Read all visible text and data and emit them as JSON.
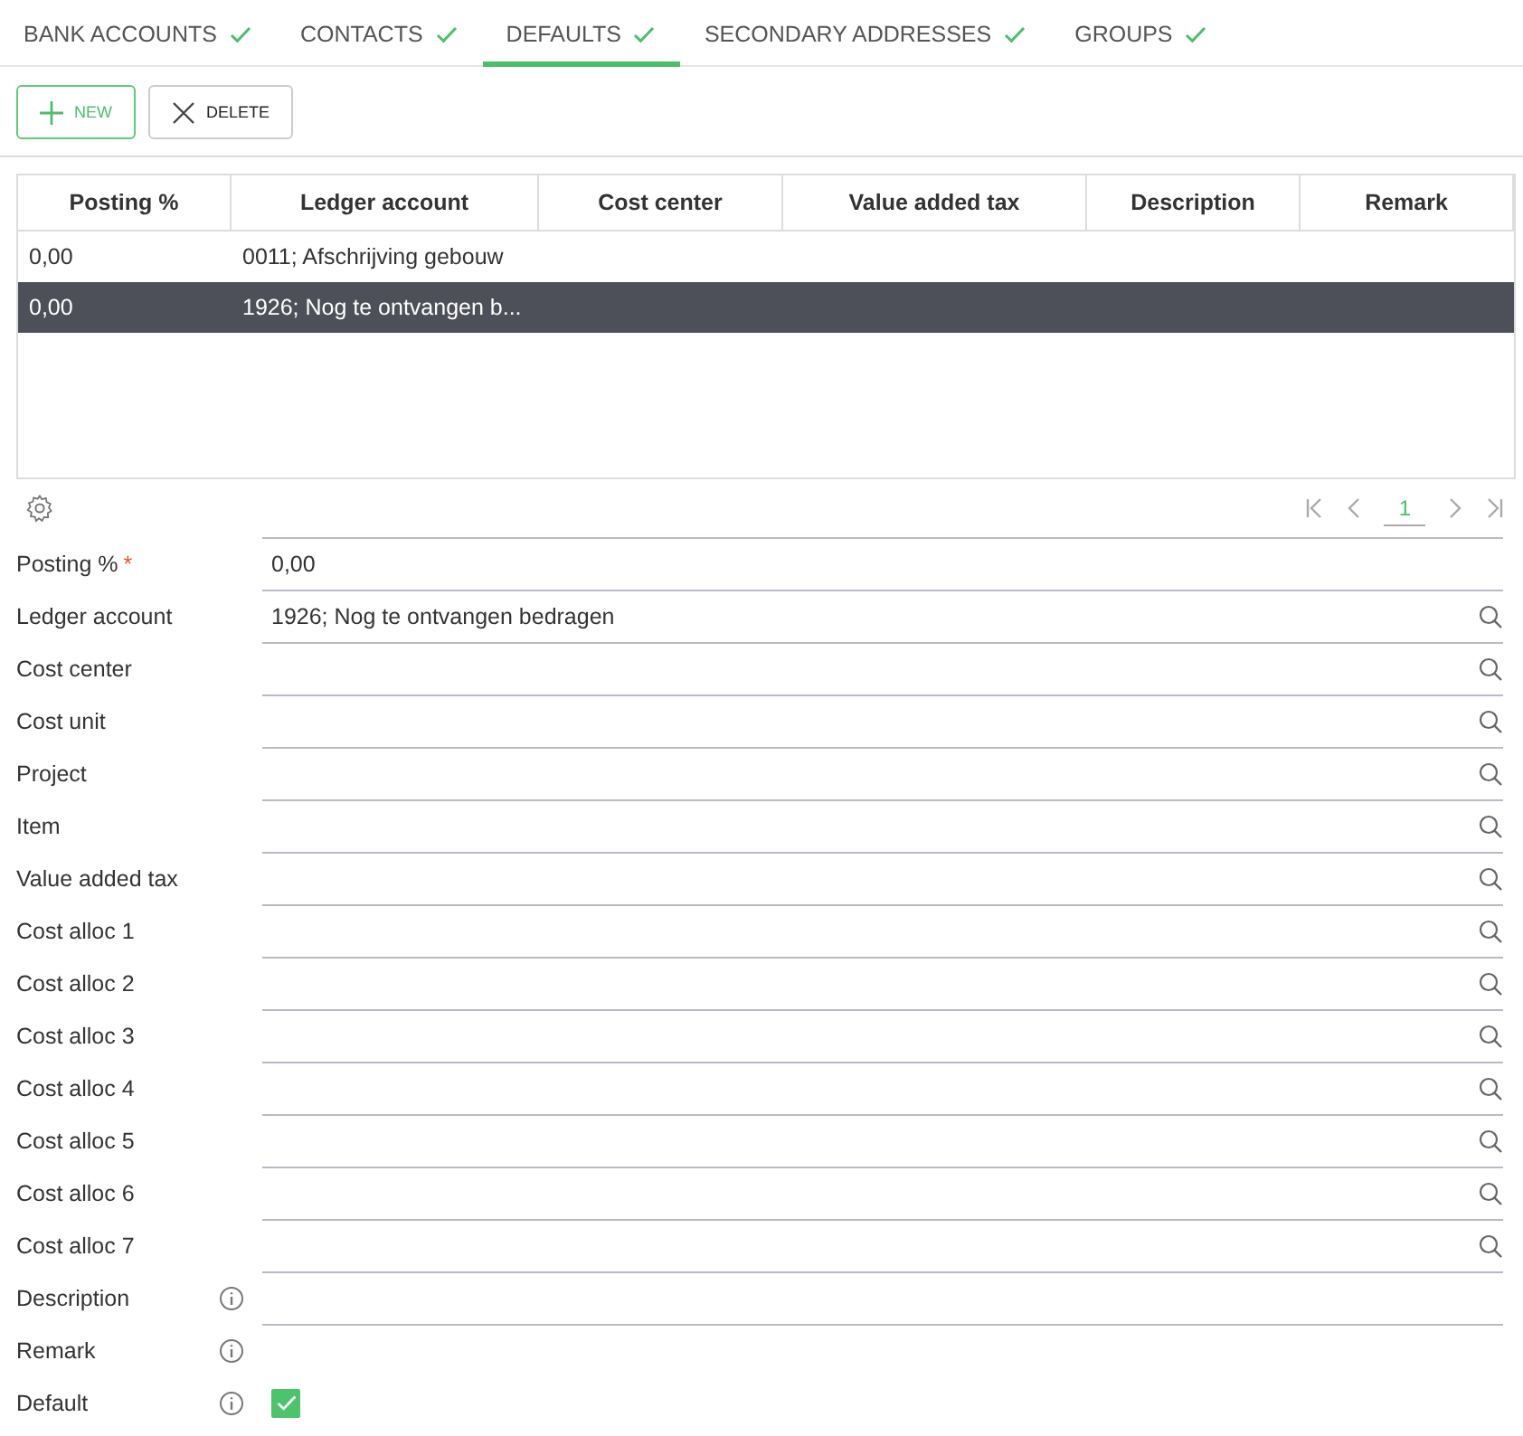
{
  "tabs": [
    {
      "label": "BANK ACCOUNTS",
      "selected": false,
      "complete": true
    },
    {
      "label": "CONTACTS",
      "selected": false,
      "complete": true
    },
    {
      "label": "DEFAULTS",
      "selected": true,
      "complete": true
    },
    {
      "label": "SECONDARY ADDRESSES",
      "selected": false,
      "complete": true
    },
    {
      "label": "GROUPS",
      "selected": false,
      "complete": true
    }
  ],
  "toolbar": [
    {
      "kind": "new",
      "label": "NEW"
    },
    {
      "kind": "delete",
      "label": "DELETE"
    }
  ],
  "table": {
    "columns": [
      "Posting %",
      "Ledger account",
      "Cost center",
      "Value added tax",
      "Description",
      "Remark"
    ],
    "rows": [
      {
        "cells": [
          "0,00",
          "0011; Afschrijving gebouw",
          "",
          "",
          "",
          ""
        ],
        "selected": false
      },
      {
        "cells": [
          "0,00",
          "1926; Nog te ontvangen b...",
          "",
          "",
          "",
          ""
        ],
        "selected": true
      }
    ]
  },
  "pagination": {
    "pages": [
      {
        "label": "1",
        "selected": true
      }
    ]
  },
  "form": [
    {
      "label": "Posting %",
      "required_mark": "*",
      "kind": "text",
      "value": "0,00",
      "info": false
    },
    {
      "label": "Ledger account",
      "kind": "lookup",
      "value": "1926; Nog te ontvangen bedragen",
      "info": false
    },
    {
      "label": "Cost center",
      "kind": "lookup",
      "info": false
    },
    {
      "label": "Cost unit",
      "kind": "lookup",
      "info": false
    },
    {
      "label": "Project",
      "kind": "lookup",
      "info": false
    },
    {
      "label": "Item",
      "kind": "lookup",
      "info": false
    },
    {
      "label": "Value added tax",
      "kind": "lookup",
      "info": false
    },
    {
      "label": "Cost alloc 1",
      "kind": "lookup",
      "info": false
    },
    {
      "label": "Cost alloc 2",
      "kind": "lookup",
      "info": false
    },
    {
      "label": "Cost alloc 3",
      "kind": "lookup",
      "info": false
    },
    {
      "label": "Cost alloc 4",
      "kind": "lookup",
      "info": false
    },
    {
      "label": "Cost alloc 5",
      "kind": "lookup",
      "info": false
    },
    {
      "label": "Cost alloc 6",
      "kind": "lookup",
      "info": false
    },
    {
      "label": "Cost alloc 7",
      "kind": "lookup",
      "info": false
    },
    {
      "label": "Description",
      "kind": "text",
      "info": true
    },
    {
      "label": "Remark",
      "kind": "text",
      "info": true
    },
    {
      "label": "Default",
      "kind": "checkbox",
      "checked": true,
      "info": true
    }
  ]
}
